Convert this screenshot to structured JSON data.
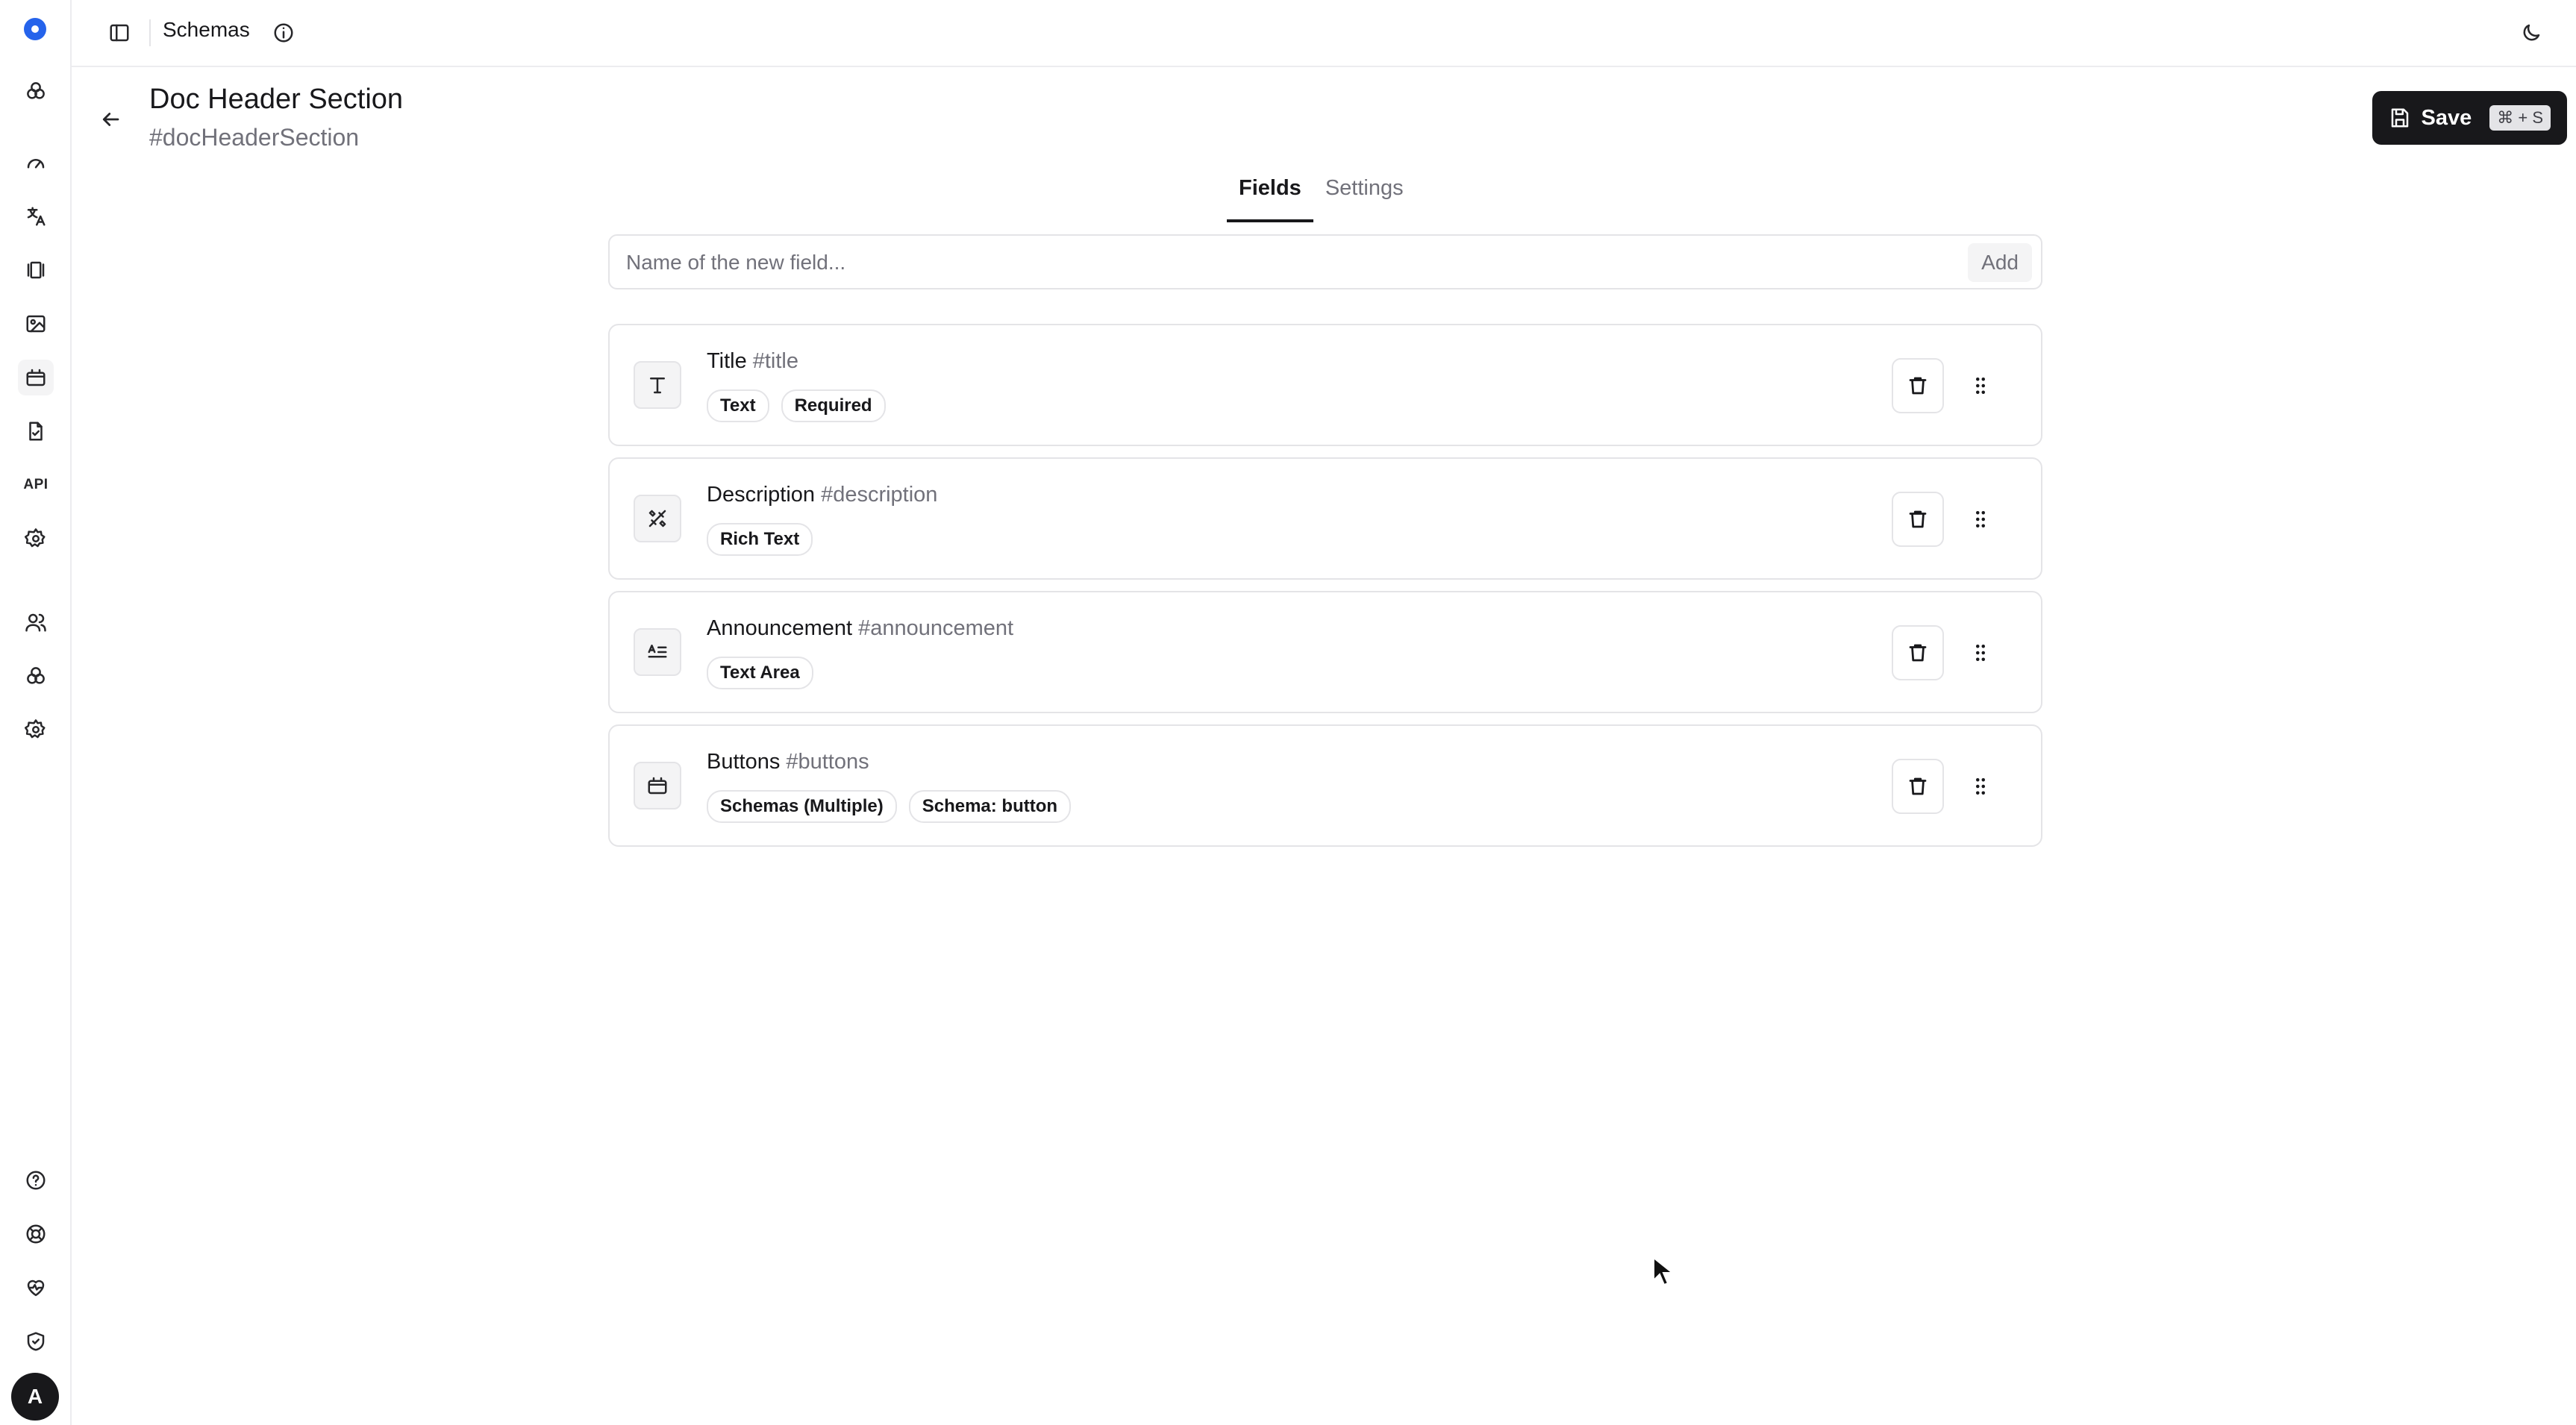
{
  "topbar": {
    "breadcrumb": "Schemas"
  },
  "header": {
    "title": "Doc Header Section",
    "subtitle": "#docHeaderSection",
    "save_label": "Save",
    "save_shortcut": "⌘ + S"
  },
  "tabs": [
    {
      "label": "Fields",
      "active": true
    },
    {
      "label": "Settings",
      "active": false
    }
  ],
  "new_field": {
    "placeholder": "Name of the new field...",
    "value": "",
    "add_label": "Add"
  },
  "fields": [
    {
      "name": "Title",
      "id": "#title",
      "icon": "text-type-icon",
      "tags": [
        "Text",
        "Required"
      ]
    },
    {
      "name": "Description",
      "id": "#description",
      "icon": "rich-text-icon",
      "tags": [
        "Rich Text"
      ]
    },
    {
      "name": "Announcement",
      "id": "#announcement",
      "icon": "text-area-icon",
      "tags": [
        "Text Area"
      ]
    },
    {
      "name": "Buttons",
      "id": "#buttons",
      "icon": "schema-icon",
      "tags": [
        "Schemas (Multiple)",
        "Schema: button"
      ]
    }
  ],
  "user": {
    "avatar_initial": "A"
  },
  "colors": {
    "primary": "#18181b",
    "logo": "#2563eb",
    "muted": "#71717a",
    "border": "#e4e4e7"
  }
}
